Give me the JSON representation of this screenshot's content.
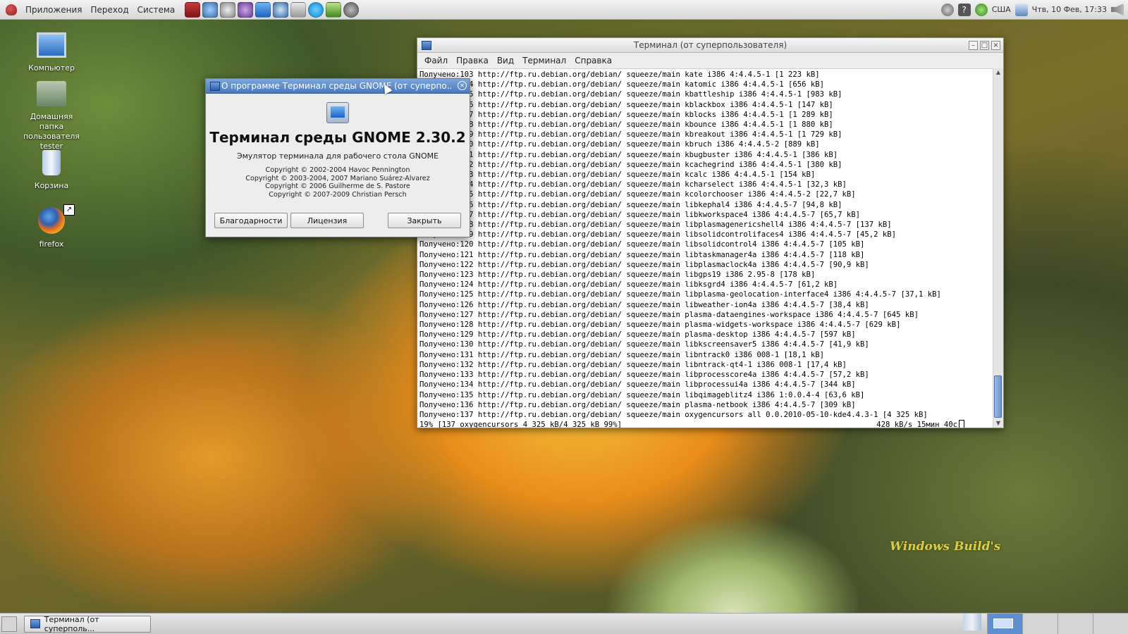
{
  "top_panel": {
    "menus": [
      "Приложения",
      "Переход",
      "Система"
    ],
    "launcher_icons": [
      "terminal-launcher-icon",
      "network-launcher-icon",
      "media-launcher-icon",
      "chat-launcher-icon",
      "screen-launcher-icon",
      "browser-launcher-icon",
      "calculator-launcher-icon",
      "skype-launcher-icon",
      "check-launcher-icon",
      "game-launcher-icon"
    ],
    "keyboard_layout": "США",
    "clock": "Чтв, 10 Фев, 17:33"
  },
  "desktop": {
    "icons": [
      {
        "label": "Компьютер",
        "icon": "computer-icon"
      },
      {
        "label": "Домашняя папка пользователя tester",
        "icon": "home-folder-icon"
      },
      {
        "label": "Корзина",
        "icon": "trash-icon"
      },
      {
        "label": "firefox",
        "icon": "firefox-icon"
      }
    ]
  },
  "terminal": {
    "title": "Терминал (от суперпользователя)",
    "menu": [
      "Файл",
      "Правка",
      "Вид",
      "Терминал",
      "Справка"
    ],
    "lines": [
      "Получено:103 http://ftp.ru.debian.org/debian/ squeeze/main kate i386 4:4.4.5-1 [1 223 kB]",
      "Получено:104 http://ftp.ru.debian.org/debian/ squeeze/main katomic i386 4:4.4.5-1 [656 kB]",
      "Получено:105 http://ftp.ru.debian.org/debian/ squeeze/main kbattleship i386 4:4.4.5-1 [983 kB]",
      "Получено:106 http://ftp.ru.debian.org/debian/ squeeze/main kblackbox i386 4:4.4.5-1 [147 kB]",
      "Получено:107 http://ftp.ru.debian.org/debian/ squeeze/main kblocks i386 4:4.4.5-1 [1 289 kB]",
      "Получено:108 http://ftp.ru.debian.org/debian/ squeeze/main kbounce i386 4:4.4.5-1 [1 880 kB]",
      "Получено:109 http://ftp.ru.debian.org/debian/ squeeze/main kbreakout i386 4:4.4.5-1 [1 729 kB]",
      "Получено:110 http://ftp.ru.debian.org/debian/ squeeze/main kbruch i386 4:4.4.5-2 [889 kB]",
      "Получено:111 http://ftp.ru.debian.org/debian/ squeeze/main kbugbuster i386 4:4.4.5-1 [386 kB]",
      "Получено:112 http://ftp.ru.debian.org/debian/ squeeze/main kcachegrind i386 4:4.4.5-1 [380 kB]",
      "Получено:113 http://ftp.ru.debian.org/debian/ squeeze/main kcalc i386 4:4.4.5-1 [154 kB]",
      "Получено:114 http://ftp.ru.debian.org/debian/ squeeze/main kcharselect i386 4:4.4.5-1 [32,3 kB]",
      "Получено:115 http://ftp.ru.debian.org/debian/ squeeze/main kcolorchooser i386 4:4.4.5-2 [22,7 kB]",
      "Получено:116 http://ftp.ru.debian.org/debian/ squeeze/main libkephal4 i386 4:4.4.5-7 [94,8 kB]",
      "Получено:117 http://ftp.ru.debian.org/debian/ squeeze/main libkworkspace4 i386 4:4.4.5-7 [65,7 kB]",
      "Получено:118 http://ftp.ru.debian.org/debian/ squeeze/main libplasmagenericshell4 i386 4:4.4.5-7 [137 kB]",
      "Получено:119 http://ftp.ru.debian.org/debian/ squeeze/main libsolidcontrolifaces4 i386 4:4.4.5-7 [45,2 kB]",
      "Получено:120 http://ftp.ru.debian.org/debian/ squeeze/main libsolidcontrol4 i386 4:4.4.5-7 [105 kB]",
      "Получено:121 http://ftp.ru.debian.org/debian/ squeeze/main libtaskmanager4a i386 4:4.4.5-7 [118 kB]",
      "Получено:122 http://ftp.ru.debian.org/debian/ squeeze/main libplasmaclock4a i386 4:4.4.5-7 [90,9 kB]",
      "Получено:123 http://ftp.ru.debian.org/debian/ squeeze/main libgps19 i386 2.95-8 [178 kB]",
      "Получено:124 http://ftp.ru.debian.org/debian/ squeeze/main libksgrd4 i386 4:4.4.5-7 [61,2 kB]",
      "Получено:125 http://ftp.ru.debian.org/debian/ squeeze/main libplasma-geolocation-interface4 i386 4:4.4.5-7 [37,1 kB]",
      "Получено:126 http://ftp.ru.debian.org/debian/ squeeze/main libweather-ion4a i386 4:4.4.5-7 [38,4 kB]",
      "Получено:127 http://ftp.ru.debian.org/debian/ squeeze/main plasma-dataengines-workspace i386 4:4.4.5-7 [645 kB]",
      "Получено:128 http://ftp.ru.debian.org/debian/ squeeze/main plasma-widgets-workspace i386 4:4.4.5-7 [629 kB]",
      "Получено:129 http://ftp.ru.debian.org/debian/ squeeze/main plasma-desktop i386 4:4.4.5-7 [597 kB]",
      "Получено:130 http://ftp.ru.debian.org/debian/ squeeze/main libkscreensaver5 i386 4:4.4.5-7 [41,9 kB]",
      "Получено:131 http://ftp.ru.debian.org/debian/ squeeze/main libntrack0 i386 008-1 [18,1 kB]",
      "Получено:132 http://ftp.ru.debian.org/debian/ squeeze/main libntrack-qt4-1 i386 008-1 [17,4 kB]",
      "Получено:133 http://ftp.ru.debian.org/debian/ squeeze/main libprocesscore4a i386 4:4.4.5-7 [57,2 kB]",
      "Получено:134 http://ftp.ru.debian.org/debian/ squeeze/main libprocessui4a i386 4:4.4.5-7 [344 kB]",
      "Получено:135 http://ftp.ru.debian.org/debian/ squeeze/main libqimageblitz4 i386 1:0.0.4-4 [63,6 kB]",
      "Получено:136 http://ftp.ru.debian.org/debian/ squeeze/main plasma-netbook i386 4:4.4.5-7 [309 kB]",
      "Получено:137 http://ftp.ru.debian.org/debian/ squeeze/main oxygencursors all 0.0.2010-05-10-kde4.4.3-1 [4 325 kB]"
    ],
    "status_left": "19% [137 oxygencursors 4 325 kB/4 325 kB 99%]",
    "status_right": "428 kB/s 15мин 40с"
  },
  "about_dialog": {
    "title": "О программе Терминал среды GNOME (от суперпо...",
    "app_name": "Терминал среды GNOME 2.30.2",
    "comment": "Эмулятор терминала для рабочего стола GNOME",
    "copyright": [
      "Copyright © 2002-2004 Havoc Pennington",
      "Copyright © 2003-2004, 2007 Mariano Suárez-Alvarez",
      "Copyright © 2006 Guilherme de S. Pastore",
      "Copyright © 2007-2009 Christian Persch"
    ],
    "buttons": {
      "credits": "Благодарности",
      "license": "Лицензия",
      "close": "Закрыть"
    }
  },
  "bottom_panel": {
    "task_label": "Терминал (от суперполь...",
    "workspaces": 4,
    "active_workspace": 1
  },
  "watermark": "Windows Build's"
}
